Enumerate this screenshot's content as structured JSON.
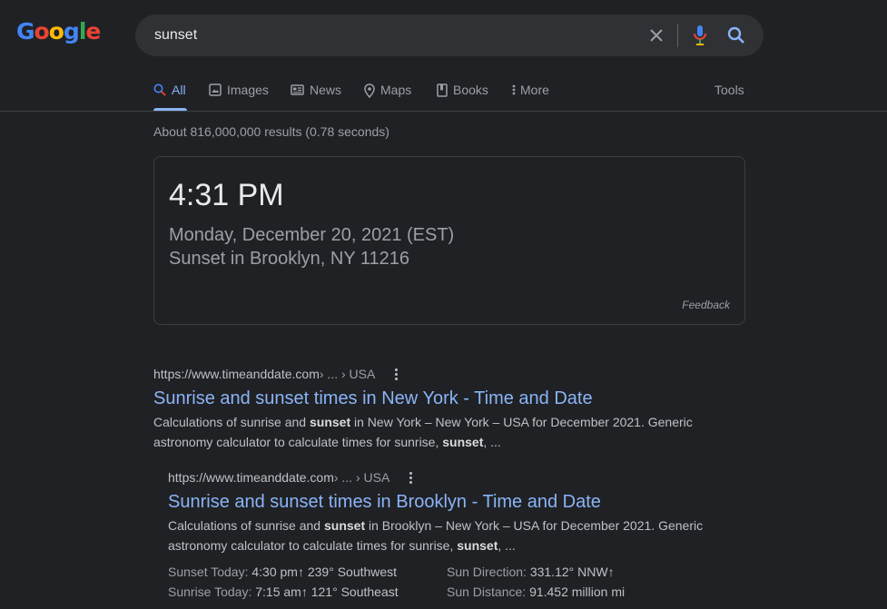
{
  "logo": {
    "letters": [
      "G",
      "o",
      "o",
      "g",
      "l",
      "e"
    ],
    "colors": [
      "#4285f4",
      "#ea4335",
      "#fbbc05",
      "#4285f4",
      "#34a853",
      "#ea4335"
    ]
  },
  "search": {
    "query": "sunset"
  },
  "tabs": [
    {
      "label": "All",
      "icon": "search-icon",
      "active": true
    },
    {
      "label": "Images",
      "icon": "image-icon"
    },
    {
      "label": "News",
      "icon": "news-icon"
    },
    {
      "label": "Maps",
      "icon": "map-pin-icon"
    },
    {
      "label": "Books",
      "icon": "book-icon"
    },
    {
      "label": "More",
      "icon": "more-vertical-icon"
    }
  ],
  "tools_label": "Tools",
  "stats": "About 816,000,000 results (0.78 seconds)",
  "answer_card": {
    "time": "4:31 PM",
    "date": "Monday, December 20, 2021 (EST)",
    "place": "Sunset in Brooklyn, NY 11216",
    "feedback": "Feedback"
  },
  "results": [
    {
      "url_base": "https://www.timeanddate.com",
      "url_path": " › ... › USA",
      "title": "Sunrise and sunset times in New York - Time and Date",
      "snippet_parts": [
        "Calculations of sunrise and ",
        "sunset",
        " in New York – New York – USA for December 2021. Generic astronomy calculator to calculate times for sunrise, ",
        "sunset",
        ", ..."
      ]
    },
    {
      "url_base": "https://www.timeanddate.com",
      "url_path": " › ... › USA",
      "title": "Sunrise and sunset times in Brooklyn - Time and Date",
      "snippet_parts": [
        "Calculations of sunrise and ",
        "sunset",
        " in Brooklyn – New York – USA for December 2021. Generic astronomy calculator to calculate times for sunrise, ",
        "sunset",
        ", ..."
      ]
    }
  ],
  "facts": {
    "sunset_label": "Sunset Today: ",
    "sunset_value": "4:30 pm↑ 239° Southwest",
    "sunrise_label": "Sunrise Today: ",
    "sunrise_value": "7:15 am↑ 121° Southeast",
    "direction_label": "Sun Direction: ",
    "direction_value": "331.12° NNW↑",
    "distance_label": "Sun Distance: ",
    "distance_value": "91.452 million mi"
  },
  "colors": {
    "background": "#202124",
    "link": "#8ab4f8",
    "mic_blue": "#4285f4",
    "mic_red": "#ea4335"
  }
}
